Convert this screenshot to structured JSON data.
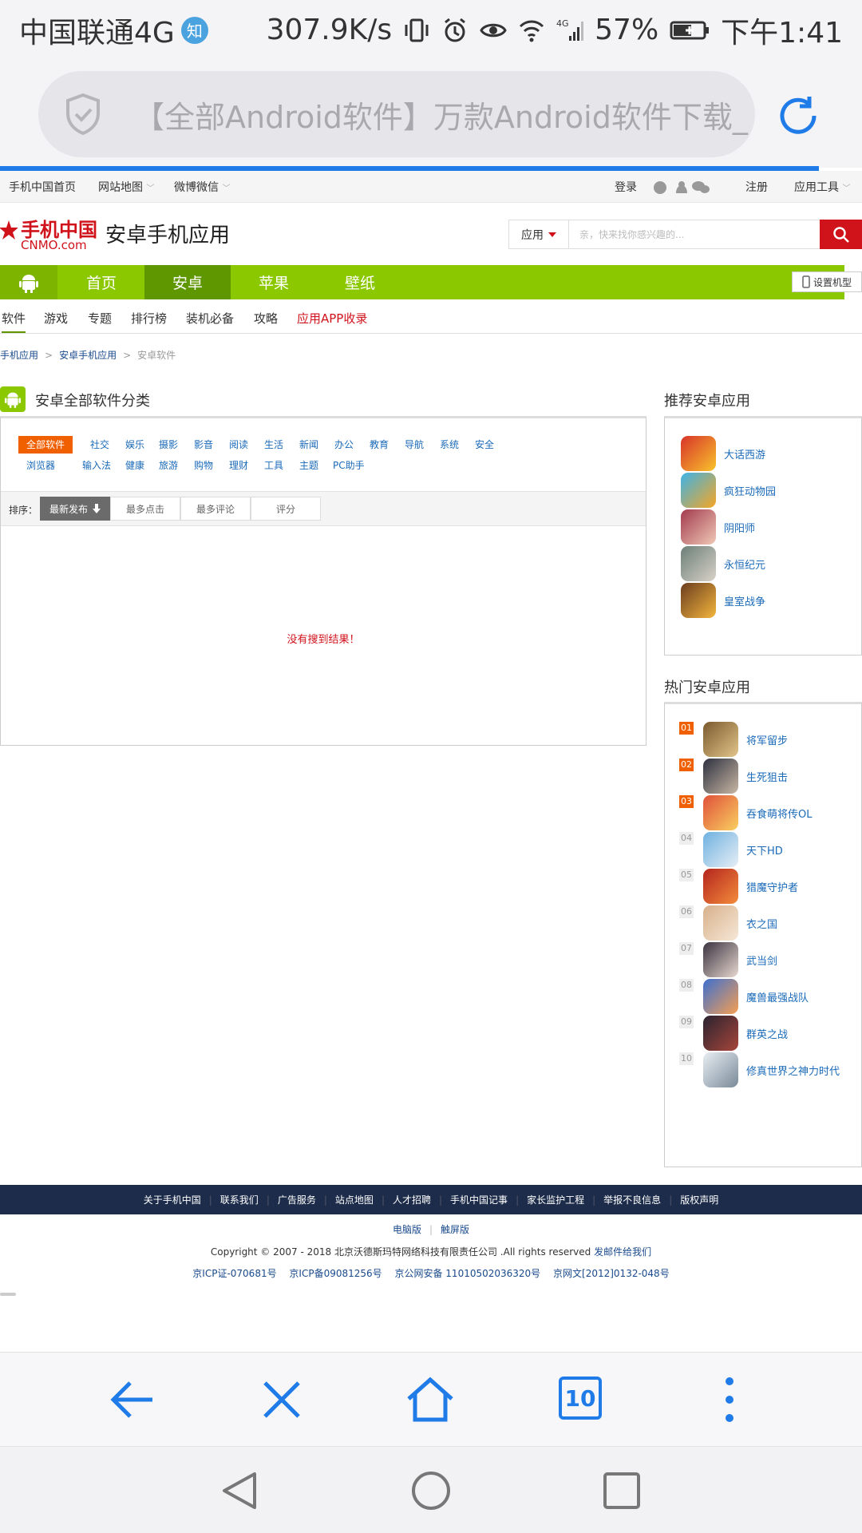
{
  "status_bar": {
    "carrier": "中国联通4G",
    "carrier_badge": "知",
    "speed": "307.9K/s",
    "network": "4G",
    "battery": "57%",
    "time": "下午1:41"
  },
  "browser": {
    "url_title": "【全部Android软件】万款Android软件下载_",
    "tab_count": "10",
    "accent_color": "#1e7be8"
  },
  "top_nav": {
    "home": "手机中国首页",
    "sitemap": "网站地图",
    "weibo": "微博微信",
    "login": "登录",
    "register": "注册",
    "tools": "应用工具"
  },
  "header": {
    "logo_cn": "手机中国",
    "logo_en": "CNMO.com",
    "site_title": "安卓手机应用",
    "search_select": "应用",
    "search_placeholder": "亲，快来找你感兴趣的..."
  },
  "green_nav": {
    "items": [
      "首页",
      "安卓",
      "苹果",
      "壁纸"
    ],
    "active": "安卓",
    "set_model": "设置机型",
    "green_color": "#8cc800"
  },
  "sub_nav": {
    "items": [
      "软件",
      "游戏",
      "专题",
      "排行榜",
      "装机必备",
      "攻略"
    ],
    "highlight": "应用APP收录"
  },
  "breadcrumb": [
    "手机应用",
    "安卓手机应用",
    "安卓软件"
  ],
  "left_panel": {
    "title": "安卓全部软件分类",
    "categories_row1": [
      "全部软件",
      "社交",
      "娱乐",
      "摄影",
      "影音",
      "阅读",
      "生活",
      "新闻",
      "办公",
      "教育",
      "导航",
      "系统",
      "安全"
    ],
    "categories_row2": [
      "浏览器",
      "输入法",
      "健康",
      "旅游",
      "购物",
      "理财",
      "工具",
      "主题",
      "PC助手"
    ],
    "sort_label": "排序：",
    "sort_options": [
      "最新发布",
      "最多点击",
      "最多评论",
      "评分"
    ],
    "empty_message": "没有搜到结果！"
  },
  "recommended": {
    "title": "推荐安卓应用",
    "apps": [
      "大话西游",
      "疯狂动物园",
      "阴阳师",
      "永恒纪元",
      "皇室战争"
    ]
  },
  "hot": {
    "title": "热门安卓应用",
    "apps": [
      {
        "rank": "01",
        "name": "将军留步"
      },
      {
        "rank": "02",
        "name": "生死狙击"
      },
      {
        "rank": "03",
        "name": "吞食萌将传OL"
      },
      {
        "rank": "04",
        "name": "天下HD"
      },
      {
        "rank": "05",
        "name": "猎魔守护者"
      },
      {
        "rank": "06",
        "name": "衣之国"
      },
      {
        "rank": "07",
        "name": "武当剑"
      },
      {
        "rank": "08",
        "name": "魔兽最强战队"
      },
      {
        "rank": "09",
        "name": "群英之战"
      },
      {
        "rank": "10",
        "name": "修真世界之神力时代"
      }
    ]
  },
  "footer": {
    "links": [
      "关于手机中国",
      "联系我们",
      "广告服务",
      "站点地图",
      "人才招聘",
      "手机中国记事",
      "家长监护工程",
      "举报不良信息",
      "版权声明"
    ],
    "versions": [
      "电脑版",
      "触屏版"
    ],
    "copyright_text": "Copyright © 2007 - 2018  北京沃德斯玛特网络科技有限责任公司 .All rights reserved",
    "email_link": "发邮件给我们",
    "icp": [
      "京ICP证-070681号",
      "京ICP备09081256号",
      "京公网安备 11010502036320号",
      "京网文[2012]0132-048号"
    ]
  }
}
